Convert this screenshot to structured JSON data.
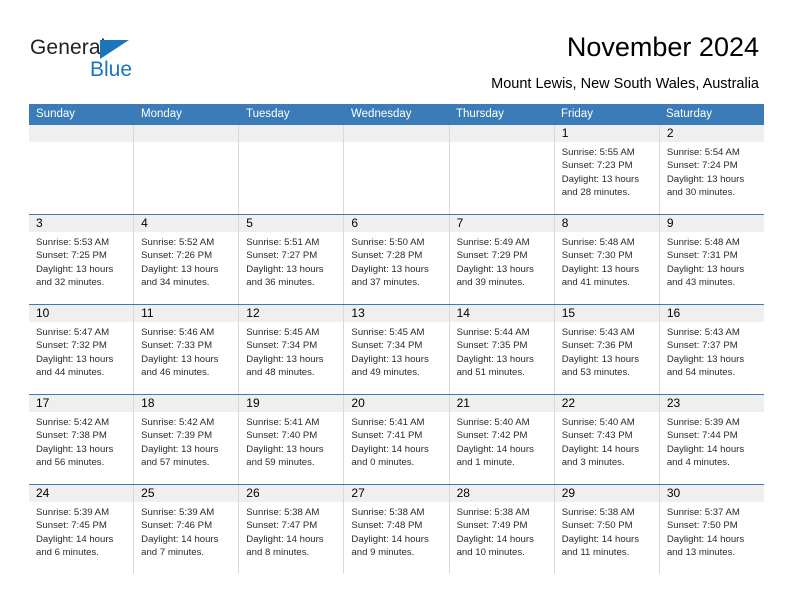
{
  "brand": {
    "name_part1": "General",
    "name_part2": "Blue",
    "accent_color": "#1b75bb"
  },
  "header": {
    "title": "November 2024",
    "subtitle": "Mount Lewis, New South Wales, Australia"
  },
  "calendar": {
    "header_bg": "#3b7cb8",
    "daynum_bg": "#efefef",
    "weekdays": [
      "Sunday",
      "Monday",
      "Tuesday",
      "Wednesday",
      "Thursday",
      "Friday",
      "Saturday"
    ],
    "labels": {
      "sunrise": "Sunrise:",
      "sunset": "Sunset:",
      "daylight": "Daylight:"
    },
    "weeks": [
      [
        {
          "day": "",
          "empty": true
        },
        {
          "day": "",
          "empty": true
        },
        {
          "day": "",
          "empty": true
        },
        {
          "day": "",
          "empty": true
        },
        {
          "day": "",
          "empty": true
        },
        {
          "day": "1",
          "sunrise": "Sunrise: 5:55 AM",
          "sunset": "Sunset: 7:23 PM",
          "daylight": "Daylight: 13 hours and 28 minutes."
        },
        {
          "day": "2",
          "sunrise": "Sunrise: 5:54 AM",
          "sunset": "Sunset: 7:24 PM",
          "daylight": "Daylight: 13 hours and 30 minutes."
        }
      ],
      [
        {
          "day": "3",
          "sunrise": "Sunrise: 5:53 AM",
          "sunset": "Sunset: 7:25 PM",
          "daylight": "Daylight: 13 hours and 32 minutes."
        },
        {
          "day": "4",
          "sunrise": "Sunrise: 5:52 AM",
          "sunset": "Sunset: 7:26 PM",
          "daylight": "Daylight: 13 hours and 34 minutes."
        },
        {
          "day": "5",
          "sunrise": "Sunrise: 5:51 AM",
          "sunset": "Sunset: 7:27 PM",
          "daylight": "Daylight: 13 hours and 36 minutes."
        },
        {
          "day": "6",
          "sunrise": "Sunrise: 5:50 AM",
          "sunset": "Sunset: 7:28 PM",
          "daylight": "Daylight: 13 hours and 37 minutes."
        },
        {
          "day": "7",
          "sunrise": "Sunrise: 5:49 AM",
          "sunset": "Sunset: 7:29 PM",
          "daylight": "Daylight: 13 hours and 39 minutes."
        },
        {
          "day": "8",
          "sunrise": "Sunrise: 5:48 AM",
          "sunset": "Sunset: 7:30 PM",
          "daylight": "Daylight: 13 hours and 41 minutes."
        },
        {
          "day": "9",
          "sunrise": "Sunrise: 5:48 AM",
          "sunset": "Sunset: 7:31 PM",
          "daylight": "Daylight: 13 hours and 43 minutes."
        }
      ],
      [
        {
          "day": "10",
          "sunrise": "Sunrise: 5:47 AM",
          "sunset": "Sunset: 7:32 PM",
          "daylight": "Daylight: 13 hours and 44 minutes."
        },
        {
          "day": "11",
          "sunrise": "Sunrise: 5:46 AM",
          "sunset": "Sunset: 7:33 PM",
          "daylight": "Daylight: 13 hours and 46 minutes."
        },
        {
          "day": "12",
          "sunrise": "Sunrise: 5:45 AM",
          "sunset": "Sunset: 7:34 PM",
          "daylight": "Daylight: 13 hours and 48 minutes."
        },
        {
          "day": "13",
          "sunrise": "Sunrise: 5:45 AM",
          "sunset": "Sunset: 7:34 PM",
          "daylight": "Daylight: 13 hours and 49 minutes."
        },
        {
          "day": "14",
          "sunrise": "Sunrise: 5:44 AM",
          "sunset": "Sunset: 7:35 PM",
          "daylight": "Daylight: 13 hours and 51 minutes."
        },
        {
          "day": "15",
          "sunrise": "Sunrise: 5:43 AM",
          "sunset": "Sunset: 7:36 PM",
          "daylight": "Daylight: 13 hours and 53 minutes."
        },
        {
          "day": "16",
          "sunrise": "Sunrise: 5:43 AM",
          "sunset": "Sunset: 7:37 PM",
          "daylight": "Daylight: 13 hours and 54 minutes."
        }
      ],
      [
        {
          "day": "17",
          "sunrise": "Sunrise: 5:42 AM",
          "sunset": "Sunset: 7:38 PM",
          "daylight": "Daylight: 13 hours and 56 minutes."
        },
        {
          "day": "18",
          "sunrise": "Sunrise: 5:42 AM",
          "sunset": "Sunset: 7:39 PM",
          "daylight": "Daylight: 13 hours and 57 minutes."
        },
        {
          "day": "19",
          "sunrise": "Sunrise: 5:41 AM",
          "sunset": "Sunset: 7:40 PM",
          "daylight": "Daylight: 13 hours and 59 minutes."
        },
        {
          "day": "20",
          "sunrise": "Sunrise: 5:41 AM",
          "sunset": "Sunset: 7:41 PM",
          "daylight": "Daylight: 14 hours and 0 minutes."
        },
        {
          "day": "21",
          "sunrise": "Sunrise: 5:40 AM",
          "sunset": "Sunset: 7:42 PM",
          "daylight": "Daylight: 14 hours and 1 minute."
        },
        {
          "day": "22",
          "sunrise": "Sunrise: 5:40 AM",
          "sunset": "Sunset: 7:43 PM",
          "daylight": "Daylight: 14 hours and 3 minutes."
        },
        {
          "day": "23",
          "sunrise": "Sunrise: 5:39 AM",
          "sunset": "Sunset: 7:44 PM",
          "daylight": "Daylight: 14 hours and 4 minutes."
        }
      ],
      [
        {
          "day": "24",
          "sunrise": "Sunrise: 5:39 AM",
          "sunset": "Sunset: 7:45 PM",
          "daylight": "Daylight: 14 hours and 6 minutes."
        },
        {
          "day": "25",
          "sunrise": "Sunrise: 5:39 AM",
          "sunset": "Sunset: 7:46 PM",
          "daylight": "Daylight: 14 hours and 7 minutes."
        },
        {
          "day": "26",
          "sunrise": "Sunrise: 5:38 AM",
          "sunset": "Sunset: 7:47 PM",
          "daylight": "Daylight: 14 hours and 8 minutes."
        },
        {
          "day": "27",
          "sunrise": "Sunrise: 5:38 AM",
          "sunset": "Sunset: 7:48 PM",
          "daylight": "Daylight: 14 hours and 9 minutes."
        },
        {
          "day": "28",
          "sunrise": "Sunrise: 5:38 AM",
          "sunset": "Sunset: 7:49 PM",
          "daylight": "Daylight: 14 hours and 10 minutes."
        },
        {
          "day": "29",
          "sunrise": "Sunrise: 5:38 AM",
          "sunset": "Sunset: 7:50 PM",
          "daylight": "Daylight: 14 hours and 11 minutes."
        },
        {
          "day": "30",
          "sunrise": "Sunrise: 5:37 AM",
          "sunset": "Sunset: 7:50 PM",
          "daylight": "Daylight: 14 hours and 13 minutes."
        }
      ]
    ]
  }
}
